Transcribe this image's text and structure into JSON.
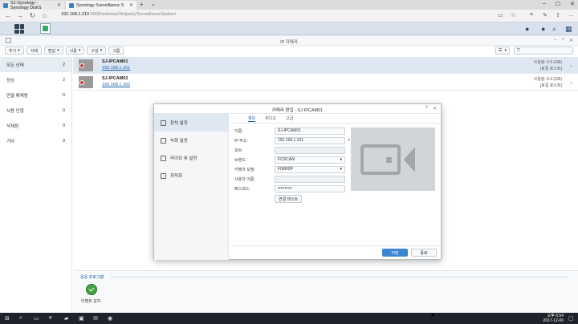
{
  "browser": {
    "tabs": [
      {
        "label": "SJ-Synology - Synology DiskS"
      },
      {
        "label": "Synology Surveillance S"
      }
    ],
    "url_host": "192.168.1.210",
    "url_path": ":5000/webman/3rdparty/SurveillanceStation/"
  },
  "window": {
    "title": "IP 카메라"
  },
  "toolbar": {
    "buttons": [
      "추가",
      "삭제",
      "편집",
      "사용",
      "구성",
      "그룹"
    ]
  },
  "sidebar": {
    "items": [
      {
        "label": "모든 상태",
        "count": "2"
      },
      {
        "label": "정상",
        "count": "2"
      },
      {
        "label": "연결 해제됨",
        "count": "0"
      },
      {
        "label": "사용 안함",
        "count": "0"
      },
      {
        "label": "삭제됨",
        "count": "0"
      },
      {
        "label": "기타",
        "count": "0"
      }
    ]
  },
  "cameras": [
    {
      "name": "SJ-IPCAM01",
      "ip": "192.168.1.161",
      "usage": "사용됨: 9.9 (GB)",
      "host": "[로컬 호스트]"
    },
    {
      "name": "SJ-IPCAM02",
      "ip": "192.168.1.162",
      "usage": "사용됨: 9.4 (GB)",
      "host": "[로컬 호스트]"
    }
  ],
  "apps": {
    "title": "응용 프로그램",
    "items": [
      {
        "label": "이벤트 감지"
      }
    ]
  },
  "dialog": {
    "title": "카메라 편집 - SJ-IPCAM01",
    "nav": [
      "장치 설정",
      "녹화 설정",
      "라이브 뷰 설정",
      "최적화"
    ],
    "tabs": [
      "정보",
      "비디오",
      "고급"
    ],
    "fields": {
      "name_label": "이름:",
      "name_value": "SJ-IPCAM01",
      "ip_label": "IP 주소:",
      "ip_value": "192.168.1.161",
      "port_label": "포트:",
      "port_value": "",
      "brand_label": "브랜드:",
      "brand_value": "FOSCAM",
      "model_label": "카메라 모델:",
      "model_value": "FI9800P",
      "user_label": "사용자 이름:",
      "user_value": "",
      "pass_label": "패스워드:",
      "pass_value": "••••••••••"
    },
    "conn_test": "연결 테스트",
    "ok": "저장",
    "cancel": "종료"
  },
  "taskbar": {
    "time": "오후 6:54",
    "date": "2017-12-06"
  }
}
